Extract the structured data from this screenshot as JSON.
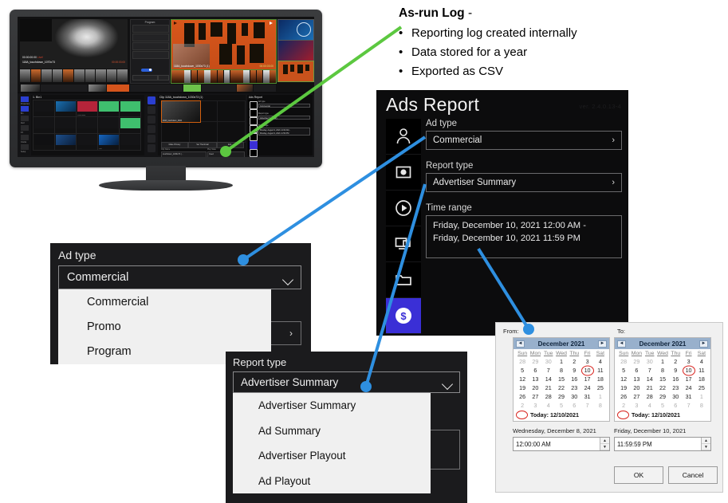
{
  "callout": {
    "heading": "As-run Log",
    "heading_suffix": "-",
    "bullets": [
      "Reporting log created internally",
      "Data stored for a year",
      "Exported as CSV"
    ]
  },
  "monitor": {
    "preview_main": {
      "timecode": "00:00:00:00",
      "live_badge": "Live!",
      "clip_name": "118A_touchdown_1070x73",
      "right_note": "00:00:03:00"
    },
    "program_panel": {
      "title": "Program",
      "item": "PRE_touchdown_HPML...",
      "loop_label": "Loop",
      "loop_state": "On"
    },
    "preview_right": {
      "clip_name": "118A_touchdown_1030x73 (1)",
      "timecode_right": "00:00:03:00"
    },
    "bin": {
      "title": "1. Bin1",
      "cells": [
        "",
        "",
        "Push Both",
        "",
        "",
        "",
        "",
        "",
        "",
        "",
        "",
        "Pull",
        "",
        "",
        "",
        "",
        "",
        "",
        "",
        ""
      ]
    },
    "clip_panel": {
      "title": "Clip 118A_touchdown_1030x73 (1)",
      "thumb_caption": "118A_touchdown_0000",
      "buttons": [
        "Make Primary",
        "Set Thumbnail",
        "Edit..."
      ],
      "field_labels": [
        "Clip Name",
        "Play State"
      ],
      "field_values": [
        "touchdown_1030x73 (...",
        "Cued"
      ]
    },
    "mini_ads": {
      "title": "Ads Report",
      "labels": [
        "Ad type",
        "Report type",
        "Time range"
      ],
      "values": [
        "Commercial",
        "Advertiser Summary",
        "Monday, August 9, 2021 12:00 AM -\nMonday, August 9, 2021 11:59 PM"
      ]
    },
    "sidebar_icons": [
      "person-icon",
      "record-icon",
      "play-icon",
      "monitor-icon",
      "folder-icon",
      "dollar-icon",
      "user-add-icon"
    ]
  },
  "ads_report": {
    "title": "Ads Report",
    "version": "ver. 2.4.0.13-4",
    "sidebar": [
      {
        "name": "person-icon"
      },
      {
        "name": "record-icon"
      },
      {
        "name": "play-icon"
      },
      {
        "name": "monitor-icon"
      },
      {
        "name": "folder-icon"
      },
      {
        "name": "dollar-icon",
        "active": true
      }
    ],
    "fields": [
      {
        "label": "Ad type",
        "value": "Commercial",
        "chevron": "›"
      },
      {
        "label": "Report type",
        "value": "Advertiser Summary",
        "chevron": "›"
      }
    ],
    "time_range": {
      "label": "Time range",
      "line1": "Friday, December 10, 2021 12:00 AM -",
      "line2": "Friday, December 10, 2021 11:59 PM"
    }
  },
  "adtype_popout": {
    "label": "Ad type",
    "selected": "Commercial",
    "options": [
      "Commercial",
      "Promo",
      "Program"
    ],
    "secondary_chevron": "›"
  },
  "reporttype_popout": {
    "label": "Report type",
    "selected": "Advertiser Summary",
    "options": [
      "Advertiser Summary",
      "Ad Summary",
      "Advertiser Playout",
      "Ad Playout"
    ]
  },
  "date_dialog": {
    "from_label": "From:",
    "to_label": "To:",
    "prev_arrow": "◄",
    "next_arrow": "►",
    "dow": [
      "Sun",
      "Mon",
      "Tue",
      "Wed",
      "Thu",
      "Fri",
      "Sat"
    ],
    "from_calendar": {
      "month_title": "December 2021",
      "weeks": [
        [
          "28",
          "29",
          "30",
          "1",
          "2",
          "3",
          "4"
        ],
        [
          "5",
          "6",
          "7",
          "8",
          "9",
          "10",
          "11"
        ],
        [
          "12",
          "13",
          "14",
          "15",
          "16",
          "17",
          "18"
        ],
        [
          "19",
          "20",
          "21",
          "22",
          "23",
          "24",
          "25"
        ],
        [
          "26",
          "27",
          "28",
          "29",
          "30",
          "31",
          "1"
        ],
        [
          "2",
          "3",
          "4",
          "5",
          "6",
          "7",
          "8"
        ]
      ],
      "dim": [
        "0-0",
        "0-1",
        "0-2",
        "4-6",
        "5-0",
        "5-1",
        "5-2",
        "5-3",
        "5-4",
        "5-5",
        "5-6"
      ],
      "selected": "1-3",
      "today": "1-5",
      "today_label": "Today: 12/10/2021"
    },
    "to_calendar": {
      "month_title": "December 2021",
      "weeks": [
        [
          "28",
          "29",
          "30",
          "1",
          "2",
          "3",
          "4"
        ],
        [
          "5",
          "6",
          "7",
          "8",
          "9",
          "10",
          "11"
        ],
        [
          "12",
          "13",
          "14",
          "15",
          "16",
          "17",
          "18"
        ],
        [
          "19",
          "20",
          "21",
          "22",
          "23",
          "24",
          "25"
        ],
        [
          "26",
          "27",
          "28",
          "29",
          "30",
          "31",
          "1"
        ],
        [
          "2",
          "3",
          "4",
          "5",
          "6",
          "7",
          "8"
        ]
      ],
      "dim": [
        "0-0",
        "0-1",
        "0-2",
        "4-6",
        "5-0",
        "5-1",
        "5-2",
        "5-3",
        "5-4",
        "5-5",
        "5-6"
      ],
      "selected": null,
      "today": "1-5",
      "today_label": "Today: 12/10/2021"
    },
    "from_date_text": "Wednesday, December 8, 2021",
    "to_date_text": "Friday, December 10, 2021",
    "from_time": "12:00:00 AM",
    "to_time": "11:59:59 PM",
    "ok_label": "OK",
    "cancel_label": "Cancel"
  },
  "colors": {
    "green_connector": "#5cc840",
    "blue_connector": "#2e8fe0",
    "accent_blue": "#3a2fd6",
    "calendar_header": "#98b0cc",
    "today_red": "#d8241f"
  }
}
